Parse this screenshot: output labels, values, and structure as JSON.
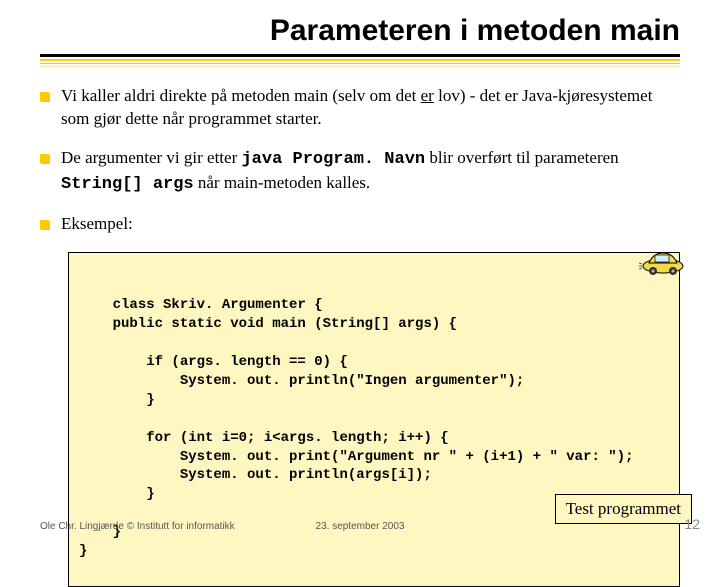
{
  "title": "Parameteren i metoden main",
  "bullets": {
    "b1_pre": "Vi kaller aldri direkte på metoden main (selv om det ",
    "b1_u": "er",
    "b1_post": " lov) - det er Java-kjøresystemet som gjør dette når programmet starter.",
    "b2_pre": "De argumenter vi gir etter ",
    "b2_code1": "java Program. Navn",
    "b2_mid": " blir overført til parameteren ",
    "b2_code2": "String[] args",
    "b2_post": " når main-metoden kalles.",
    "b3": "Eksempel:"
  },
  "code": "class Skriv. Argumenter {\n    public static void main (String[] args) {\n\n        if (args. length == 0) {\n            System. out. println(\"Ingen argumenter\");\n        }\n\n        for (int i=0; i<args. length; i++) {\n            System. out. print(\"Argument nr \" + (i+1) + \" var: \");\n            System. out. println(args[i]);\n        }\n\n    }\n}",
  "testbox": "Test programmet",
  "footer": {
    "left": "Ole Chr. Lingjærde © Institutt for informatikk",
    "center": "23. september 2003",
    "page": "12"
  }
}
